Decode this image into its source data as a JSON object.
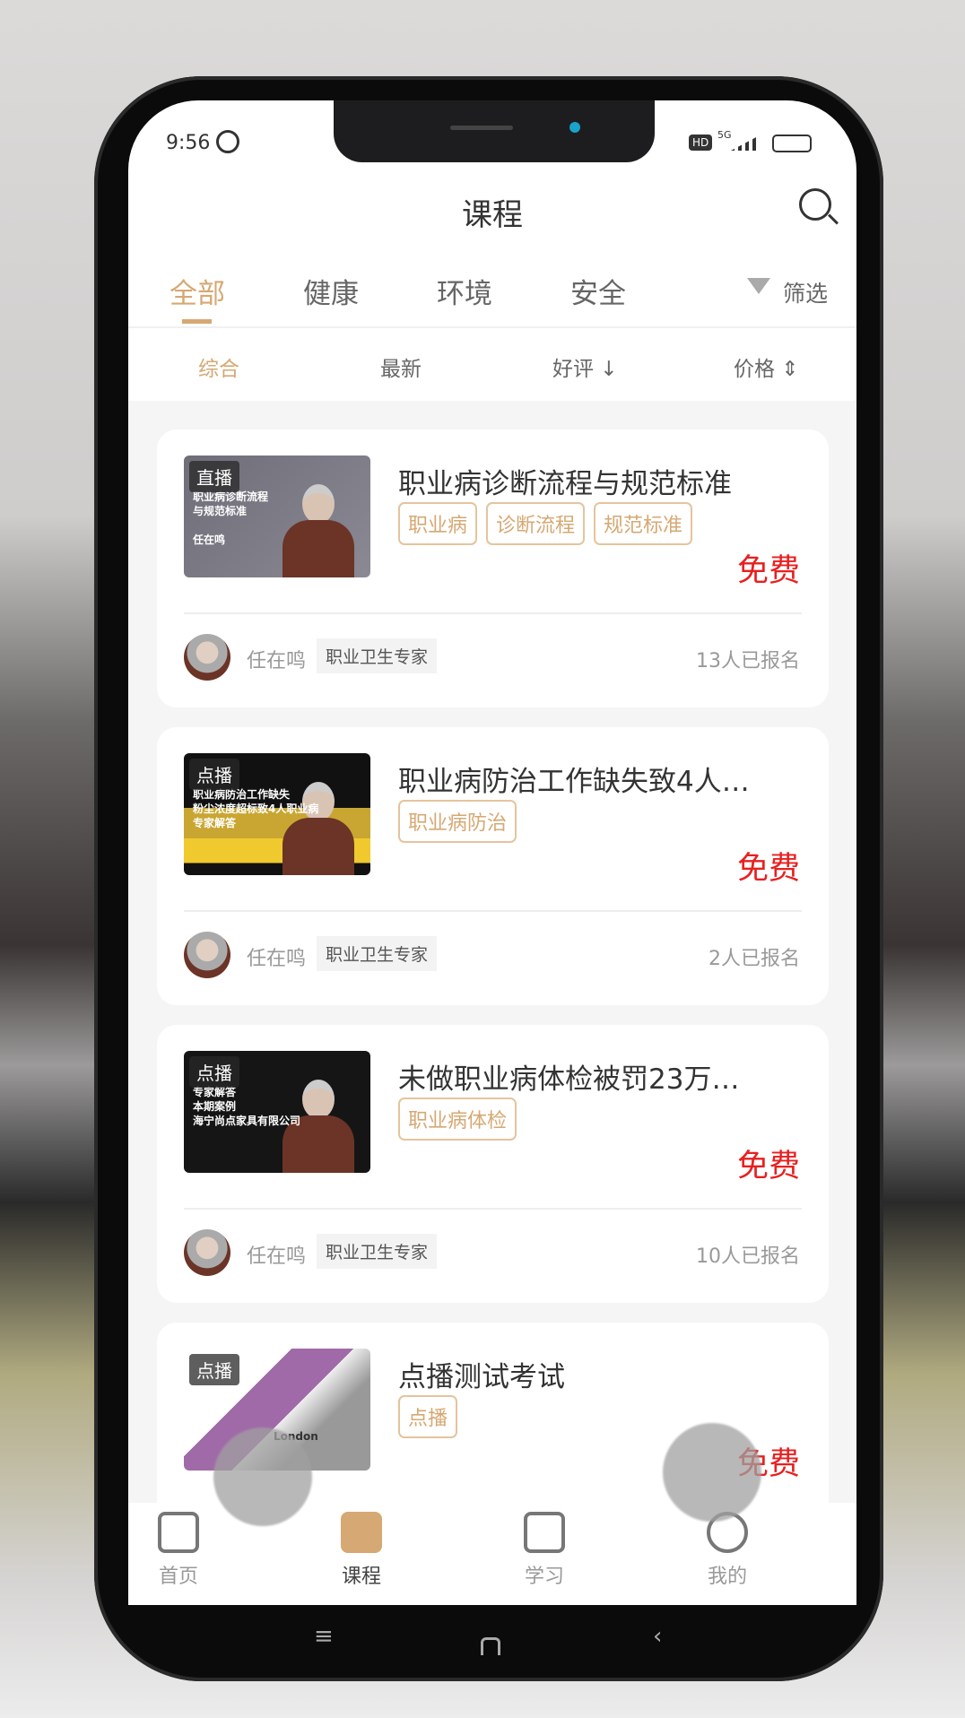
{
  "status": {
    "time": "9:56",
    "network": "5G",
    "hd": "HD"
  },
  "header": {
    "title": "课程"
  },
  "tabs": [
    {
      "label": "全部",
      "active": true
    },
    {
      "label": "健康"
    },
    {
      "label": "环境"
    },
    {
      "label": "安全"
    }
  ],
  "filter_label": "筛选",
  "sort": [
    {
      "label": "综合",
      "active": true
    },
    {
      "label": "最新"
    },
    {
      "label": "好评 ↓"
    },
    {
      "label": "价格 ⇕"
    }
  ],
  "accent": "#d6a873",
  "price_color": "#e81f1f",
  "courses": [
    {
      "badge": "直播",
      "thumb_text": "职业病诊断流程\n与规范标准\n\n任在鸣",
      "thumb_style": "gray",
      "title": "职业病诊断流程与规范标准",
      "tags": [
        "职业病",
        "诊断流程",
        "规范标准"
      ],
      "price": "免费",
      "teacher": "任在鸣",
      "role": "职业卫生专家",
      "enrolled": "13人已报名"
    },
    {
      "badge": "点播",
      "thumb_text": "职业病防治工作缺失\n粉尘浓度超标致4人职业病\n专家解答",
      "thumb_style": "black-gold",
      "title": "职业病防治工作缺失致4人…",
      "tags": [
        "职业病防治"
      ],
      "price": "免费",
      "teacher": "任在鸣",
      "role": "职业卫生专家",
      "enrolled": "2人已报名"
    },
    {
      "badge": "点播",
      "thumb_text": "专家解答\n本期案例\n海宁尚点家具有限公司",
      "thumb_style": "black",
      "title": "未做职业病体检被罚23万…",
      "tags": [
        "职业病体检"
      ],
      "price": "免费",
      "teacher": "任在鸣",
      "role": "职业卫生专家",
      "enrolled": "10人已报名"
    },
    {
      "badge": "点播",
      "thumb_text": "London",
      "thumb_style": "book",
      "title": "点播测试考试",
      "tags": [
        "点播"
      ],
      "price": "免费"
    }
  ],
  "bottom_nav": [
    {
      "label": "首页",
      "icon": "home-icon"
    },
    {
      "label": "课程",
      "icon": "course-icon",
      "active": true
    },
    {
      "label": "学习",
      "icon": "study-icon"
    },
    {
      "label": "我的",
      "icon": "profile-icon"
    }
  ]
}
